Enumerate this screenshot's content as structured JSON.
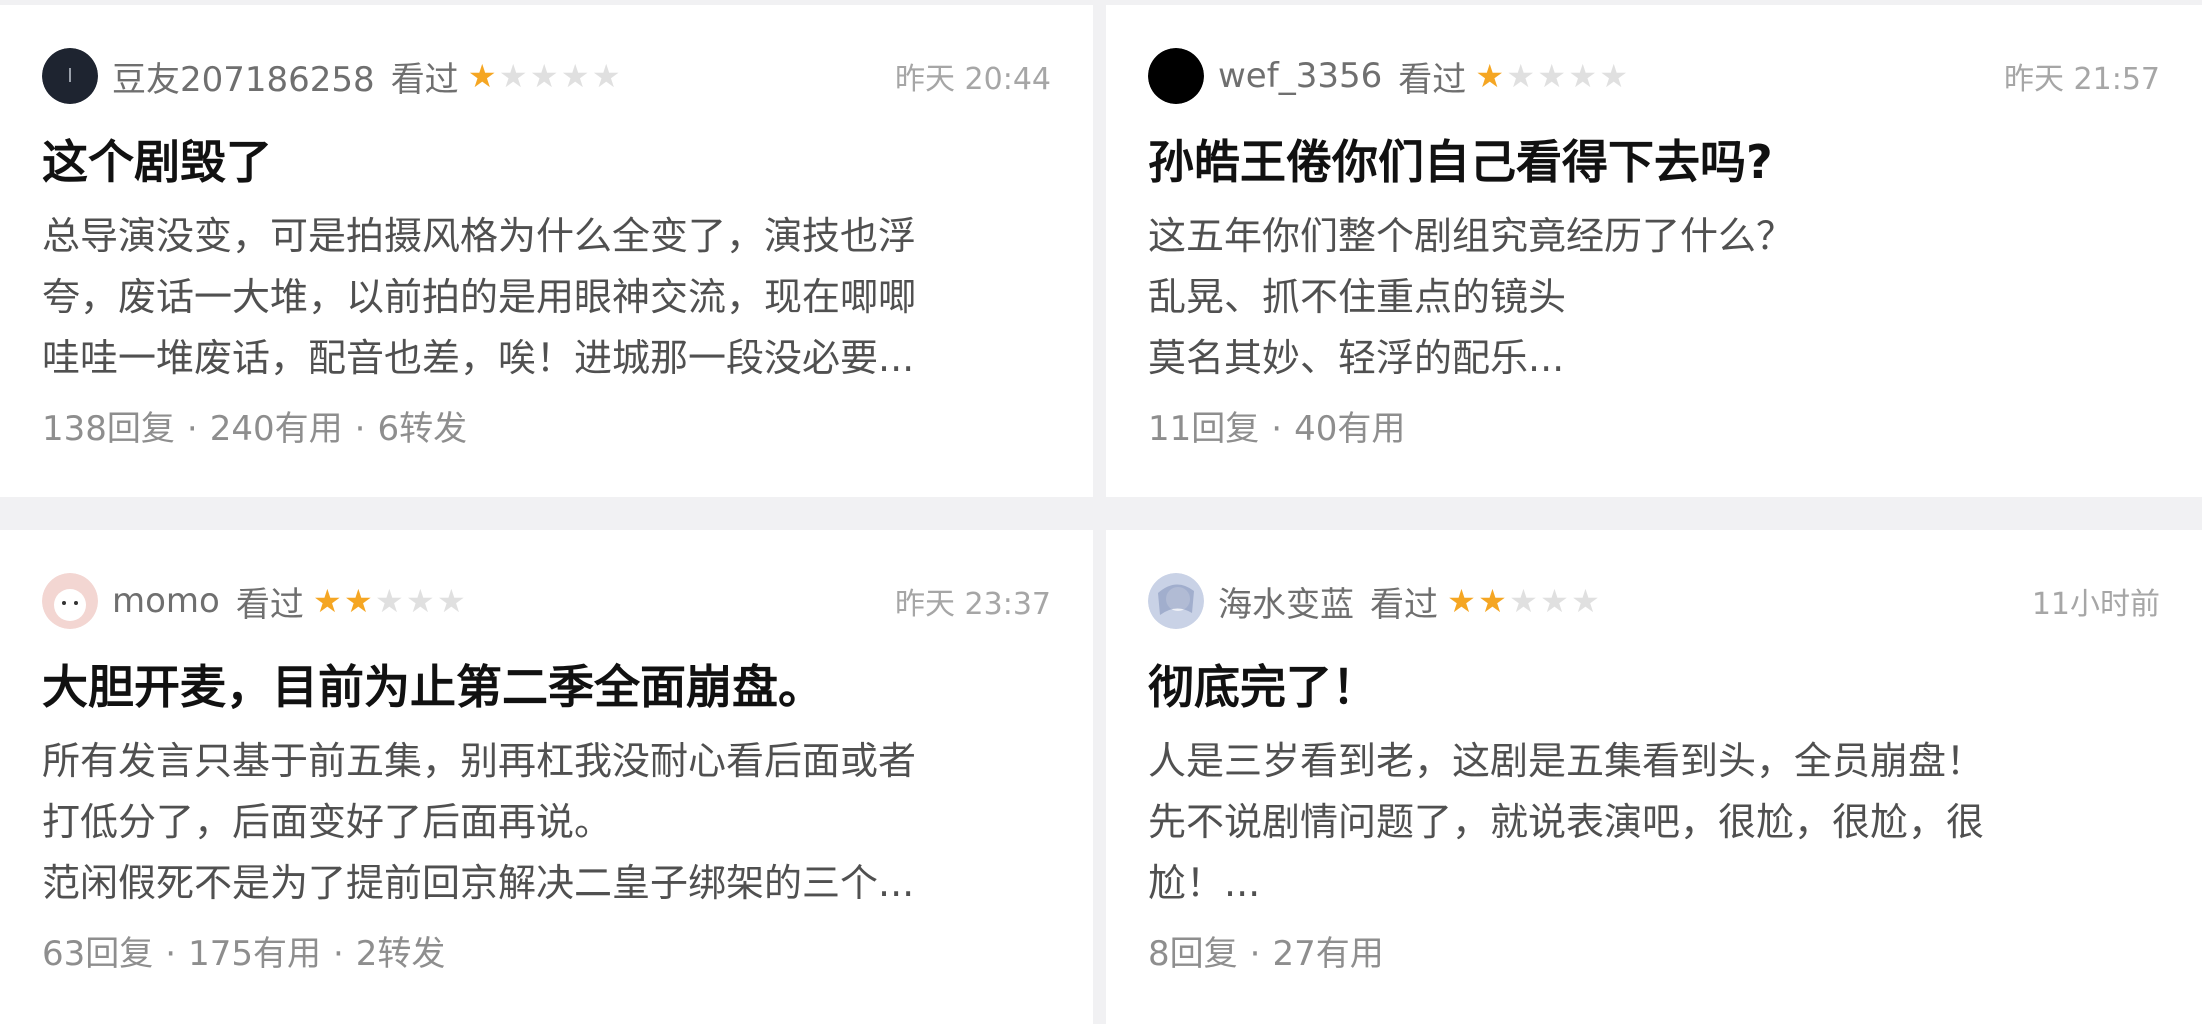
{
  "reviews": [
    {
      "username": "豆友207186258",
      "watched": "看过",
      "rating": 1,
      "time": "昨天 20:44",
      "title": "这个剧毁了",
      "lines": [
        "总导演没变，可是拍摄风格为什么全变了，演技也浮",
        "夸，废话一大堆，以前拍的是用眼神交流，现在唧唧",
        "哇哇一堆废话，配音也差，唉！进城那一段没必要..."
      ],
      "stats": [
        "138回复",
        "240有用",
        "6转发"
      ],
      "avatar_color": "#1e2430"
    },
    {
      "username": "wef_3356",
      "watched": "看过",
      "rating": 1,
      "time": "昨天 21:57",
      "title": "孙皓王倦你们自己看得下去吗?",
      "lines": [
        "这五年你们整个剧组究竟经历了什么？",
        "乱晃、抓不住重点的镜头",
        "莫名其妙、轻浮的配乐..."
      ],
      "stats": [
        "11回复",
        "40有用"
      ],
      "avatar_color": "#000000"
    },
    {
      "username": "momo",
      "watched": "看过",
      "rating": 2,
      "time": "昨天 23:37",
      "title": "大胆开麦，目前为止第二季全面崩盘。",
      "lines": [
        "所有发言只基于前五集，别再杠我没耐心看后面或者",
        "打低分了，后面变好了后面再说。",
        "范闲假死不是为了提前回京解决二皇子绑架的三个..."
      ],
      "stats": [
        "63回复",
        "175有用",
        "2转发"
      ],
      "avatar_color": "#f3d6d2"
    },
    {
      "username": "海水变蓝",
      "watched": "看过",
      "rating": 2,
      "time": "11小时前",
      "title": "彻底完了！",
      "lines": [
        "人是三岁看到老，这剧是五集看到头，全员崩盘！",
        "先不说剧情问题了，就说表演吧，很尬，很尬，很",
        "尬！..."
      ],
      "stats": [
        "8回复",
        "27有用"
      ],
      "avatar_color": "#c9d2e6"
    }
  ],
  "colors": {
    "star_on": "#f5a623",
    "star_off": "#e0e0e0"
  },
  "icons": {
    "star": "star-icon",
    "avatar": "user-avatar"
  }
}
